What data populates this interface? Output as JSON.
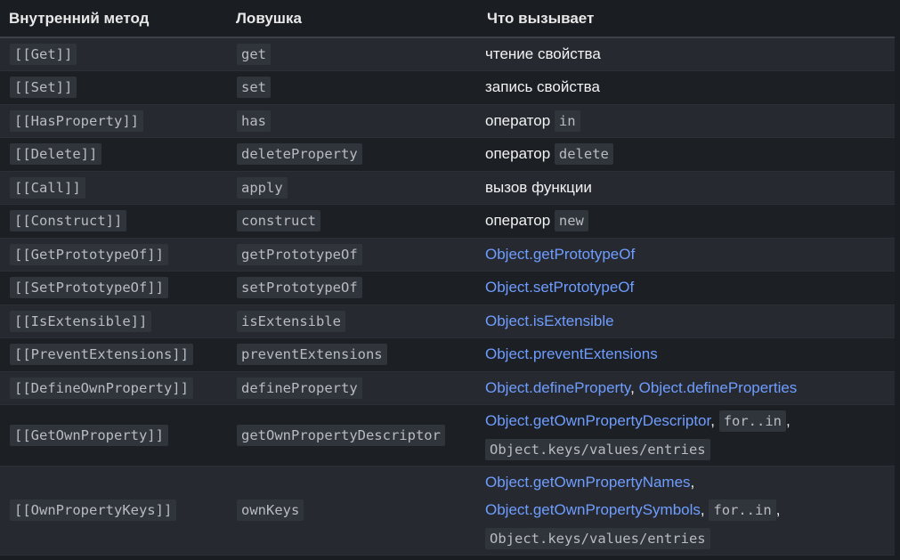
{
  "header": {
    "col1": "Внутренний метод",
    "col2": "Ловушка",
    "col3": "Что вызывает"
  },
  "rows": [
    {
      "method": "[[Get]]",
      "trap": "get",
      "desc": "чтение свойства"
    },
    {
      "method": "[[Set]]",
      "trap": "set",
      "desc": "запись свойства"
    },
    {
      "method": "[[HasProperty]]",
      "trap": "has",
      "desc_text": "оператор",
      "desc_code": "in"
    },
    {
      "method": "[[Delete]]",
      "trap": "deleteProperty",
      "desc_text": "оператор",
      "desc_code": "delete"
    },
    {
      "method": "[[Call]]",
      "trap": "apply",
      "desc": "вызов функции"
    },
    {
      "method": "[[Construct]]",
      "trap": "construct",
      "desc_text": "оператор",
      "desc_code": "new"
    },
    {
      "method": "[[GetPrototypeOf]]",
      "trap": "getPrototypeOf",
      "link": "Object.getPrototypeOf"
    },
    {
      "method": "[[SetPrototypeOf]]",
      "trap": "setPrototypeOf",
      "link": "Object.setPrototypeOf"
    },
    {
      "method": "[[IsExtensible]]",
      "trap": "isExtensible",
      "link": "Object.isExtensible"
    },
    {
      "method": "[[PreventExtensions]]",
      "trap": "preventExtensions",
      "link": "Object.preventExtensions"
    },
    {
      "method": "[[DefineOwnProperty]]",
      "trap": "defineProperty",
      "link1": "Object.defineProperty",
      "link2": "Object.defineProperties"
    },
    {
      "method": "[[GetOwnProperty]]",
      "trap": "getOwnPropertyDescriptor",
      "link": "Object.getOwnPropertyDescriptor",
      "code1": "for..in",
      "code2": "Object.keys/values/entries"
    },
    {
      "method": "[[OwnPropertyKeys]]",
      "trap": "ownKeys",
      "link1": "Object.getOwnPropertyNames",
      "link2": "Object.getOwnPropertySymbols",
      "code1": "for..in",
      "code2": "Object.keys/values/entries"
    }
  ],
  "separators": {
    "comma": ","
  }
}
